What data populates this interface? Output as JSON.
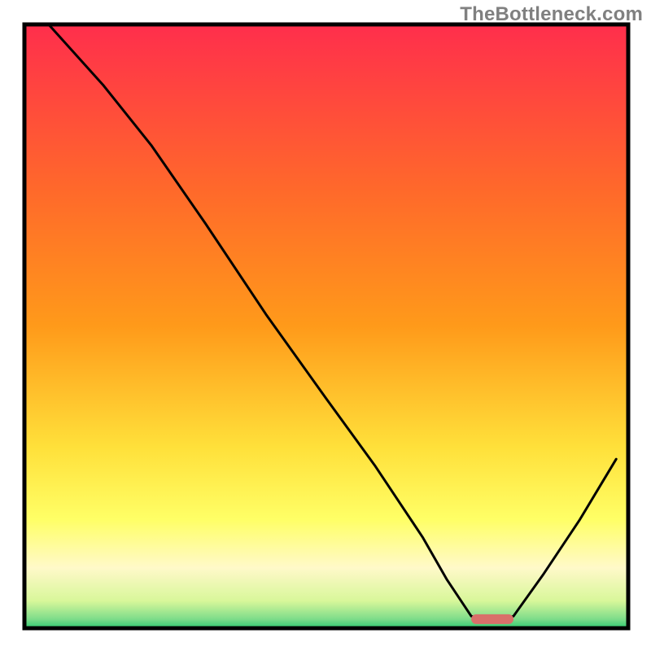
{
  "watermark": {
    "text": "TheBottleneck.com"
  },
  "colors": {
    "frame": "#000000",
    "curve": "#000000",
    "marker": "#d9706a",
    "gradient_top": "#ff2e4c",
    "gradient_mid_upper": "#ff9a1a",
    "gradient_mid_lower": "#ffff66",
    "gradient_cream": "#fff9c9",
    "gradient_near_bottom": "#d8f79a",
    "gradient_bottom": "#2ecc71"
  },
  "chart_data": {
    "type": "line",
    "title": "",
    "xlabel": "",
    "ylabel": "",
    "xlim": [
      0,
      100
    ],
    "ylim": [
      0,
      100
    ],
    "grid": false,
    "legend": false,
    "notes": "Axes unlabeled. Vertical gradient background from red (top) through orange/yellow to green (bottom). Single black curve with a kink near x≈21 then descending to a flat trough near x≈74–81, then rising. A small horizontal red rounded marker sits at the trough on the baseline.",
    "series": [
      {
        "name": "curve",
        "x": [
          4,
          13,
          21,
          30,
          40,
          50,
          58,
          66,
          70,
          74,
          78,
          81,
          86,
          92,
          98
        ],
        "values": [
          100,
          90,
          80,
          67,
          52,
          38,
          27,
          15,
          8,
          2,
          1,
          2,
          9,
          18,
          28
        ]
      }
    ],
    "marker": {
      "x_start": 74,
      "x_end": 81,
      "y": 1.5
    }
  }
}
